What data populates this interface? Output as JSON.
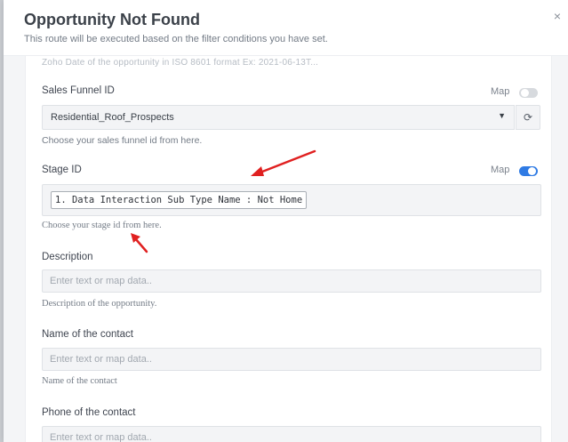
{
  "modal": {
    "title": "Opportunity Not Found",
    "subtitle": "This route will be executed based on the filter conditions you have set.",
    "close_glyph": "×"
  },
  "faded_text": "Zoho Date of the opportunity in ISO 8601 format Ex: 2021-06-13T...",
  "fields": {
    "sales_funnel": {
      "label": "Sales Funnel ID",
      "map_label": "Map",
      "map_enabled": false,
      "value": "Residential_Roof_Prospects",
      "help": "Choose your sales funnel id from here."
    },
    "stage": {
      "label": "Stage ID",
      "map_label": "Map",
      "map_enabled": true,
      "chip": "1. Data Interaction Sub Type Name : Not Home",
      "help": "Choose your stage id from here."
    },
    "description": {
      "label": "Description",
      "placeholder": "Enter text or map data..",
      "help": "Description of the opportunity."
    },
    "contact_name": {
      "label": "Name of the contact",
      "placeholder": "Enter text or map data..",
      "help": "Name of the contact"
    },
    "contact_phone": {
      "label": "Phone of the contact",
      "placeholder": "Enter text or map data.."
    }
  },
  "icons": {
    "caret": "caret-down-icon",
    "refresh": "refresh-icon",
    "close": "close-icon"
  },
  "colors": {
    "toggle_on": "#2f7be4",
    "toggle_off": "#d7dade",
    "annotation_arrow": "#e02020"
  }
}
